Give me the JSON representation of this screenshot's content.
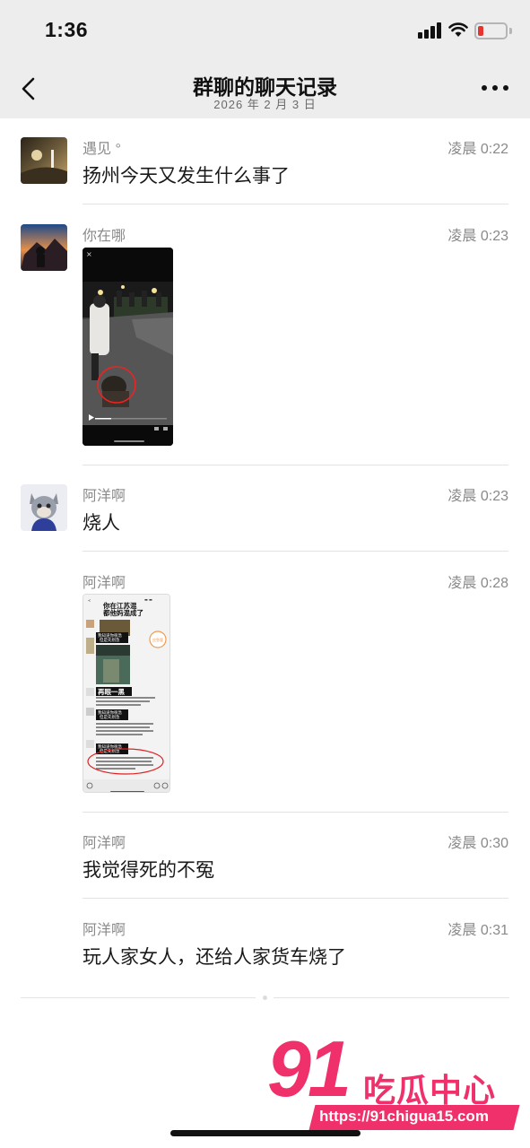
{
  "status_bar": {
    "time": "1:36"
  },
  "header": {
    "title": "群聊的聊天记录",
    "subtitle": "2026 年 2 月 3 日"
  },
  "messages": [
    {
      "sender": "遇见 °",
      "time": "凌晨 0:22",
      "text": "扬州今天又发生什么事了",
      "type": "text"
    },
    {
      "sender": "你在哪",
      "time": "凌晨 0:23",
      "type": "video"
    },
    {
      "sender": "阿洋啊",
      "time": "凌晨 0:23",
      "text": "烧人",
      "type": "text"
    },
    {
      "sender": "阿洋啊",
      "time": "凌晨 0:28",
      "type": "image",
      "image_text": {
        "title": "你在江苏混\n都他妈混成了",
        "caption_a": "我知道你很急\n但是先别急",
        "heading": "再眼一黑"
      }
    },
    {
      "sender": "阿洋啊",
      "time": "凌晨 0:30",
      "text": "我觉得死的不冤",
      "type": "text"
    },
    {
      "sender": "阿洋啊",
      "time": "凌晨 0:31",
      "text": "玩人家女人，还给人家货车烧了",
      "type": "text"
    }
  ],
  "watermark": {
    "brand_number": "91",
    "brand_text": "吃瓜中心",
    "url": "https://91chigua15.com"
  },
  "colors": {
    "chrome_bg": "#ededed",
    "meta_gray": "#8a8a8a",
    "battery_red": "#e5352f",
    "watermark_pink": "#f0306a"
  },
  "icons": [
    "back-chevron-icon",
    "more-dots-icon",
    "signal-icon",
    "wifi-icon",
    "battery-icon",
    "play-icon"
  ]
}
